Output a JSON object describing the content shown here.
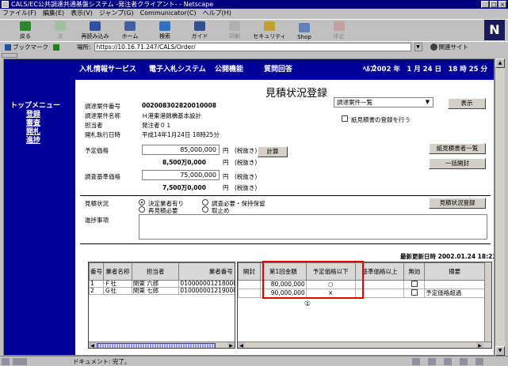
{
  "window": {
    "title": "CALS/EC公共調達共通基盤システム -発注者クライアント- - Netscape",
    "controls": [
      "_",
      "□",
      "×"
    ]
  },
  "menu": [
    "ファイル(F)",
    "編集(E)",
    "表示(V)",
    "ジャンプ(G)",
    "Communicator(C)",
    "ヘルプ(H)"
  ],
  "toolbar": [
    {
      "label": "戻る",
      "icon": "back-arrow-icon",
      "enabled": true
    },
    {
      "label": "次",
      "icon": "forward-arrow-icon",
      "enabled": false
    },
    {
      "label": "再読み込み",
      "icon": "reload-icon",
      "enabled": true
    },
    {
      "label": "ホーム",
      "icon": "home-icon",
      "enabled": true
    },
    {
      "label": "検索",
      "icon": "search-icon",
      "enabled": true
    },
    {
      "label": "ガイド",
      "icon": "guide-icon",
      "enabled": true
    },
    {
      "label": "印刷",
      "icon": "print-icon",
      "enabled": false
    },
    {
      "label": "セキュリティ",
      "icon": "security-lock-icon",
      "enabled": true
    },
    {
      "label": "Shop",
      "icon": "shop-icon",
      "enabled": true
    },
    {
      "label": "中止",
      "icon": "stop-icon",
      "enabled": false
    }
  ],
  "brand_logo": "N",
  "location": {
    "bookmark_label": "ブックマーク",
    "location_label": "場所:",
    "url": "https://10.16.71.247/CALS/Order/",
    "related_label": "関連サイト"
  },
  "nav": {
    "items": [
      "入札情報サービス",
      "電子入札システム",
      "公開機能",
      "質問回答"
    ],
    "help": "ﾍﾙﾌﾟ",
    "date": "2002 年　1 月 24 日　18 時 25 分"
  },
  "sidebar": {
    "title": "トップメニュー",
    "items": [
      "登録",
      "審査",
      "開札",
      "進捗"
    ]
  },
  "page": {
    "title": "見積状況登録",
    "fields": [
      {
        "label": "調達案件番号",
        "value": "002008302820010008"
      },
      {
        "label": "調達案件名称",
        "value": "Ｈ港東港錦橋基本設計"
      },
      {
        "label": "担当者",
        "value": "発注者０１"
      },
      {
        "label": "開札執行日時",
        "value": "平成14年1月24日 18時25分"
      }
    ],
    "yotei_label": "予定価格",
    "yotei_value": "85,000,000",
    "yotei_unit": "円　(税抜き)",
    "yotei_man": "8,500万0,000",
    "yotei_man_unit": "円　(税抜き)",
    "kijun_label": "調査基準価格",
    "kijun_value": "75,000,000",
    "kijun_unit": "円　(税抜き)",
    "kijun_man": "7,500万0,000",
    "kijun_man_unit": "円　(税抜き)",
    "calc_button": "計算",
    "select_value": "調達案件一覧",
    "display_button": "表示",
    "checkbox_label": "紙見積書の登録を行う",
    "paper_list_button": "紙見積書者一覧",
    "bulk_button": "一括開封",
    "status_label": "見積状況",
    "radios": [
      {
        "label": "決定業者有り",
        "checked": true
      },
      {
        "label": "調査必要・保持保留",
        "checked": false
      },
      {
        "label": "再見積必要",
        "checked": false
      },
      {
        "label": "取止め",
        "checked": false
      }
    ],
    "register_button": "見積状況登録",
    "notes_label": "進捗事項",
    "last_updated": "最新更新日時 2002.01.24 18:23"
  },
  "left_table": {
    "headers": [
      "番号",
      "業者名称",
      "担当者",
      "業者番号"
    ],
    "rows": [
      [
        "1",
        "Ｆ社",
        "関東 六郎",
        "0100000012180001"
      ],
      [
        "2",
        "Ｇ社",
        "関東 七郎",
        "0100000012190001"
      ]
    ]
  },
  "right_table": {
    "headers": [
      "開封",
      "第1回金額",
      "予定価格以下",
      "基準価格以上",
      "無効",
      "摘要"
    ],
    "rows": [
      [
        "",
        "80,000,000",
        "○",
        "",
        "",
        ""
      ],
      [
        "",
        "90,000,000",
        "×",
        "",
        "",
        "予定価格超過"
      ]
    ]
  },
  "annotation": "①",
  "status_bar": "ドキュメント: 完了。",
  "colors": {
    "nav_bg": "#000099",
    "highlight": "#e00000",
    "titlebar": "#000080"
  }
}
